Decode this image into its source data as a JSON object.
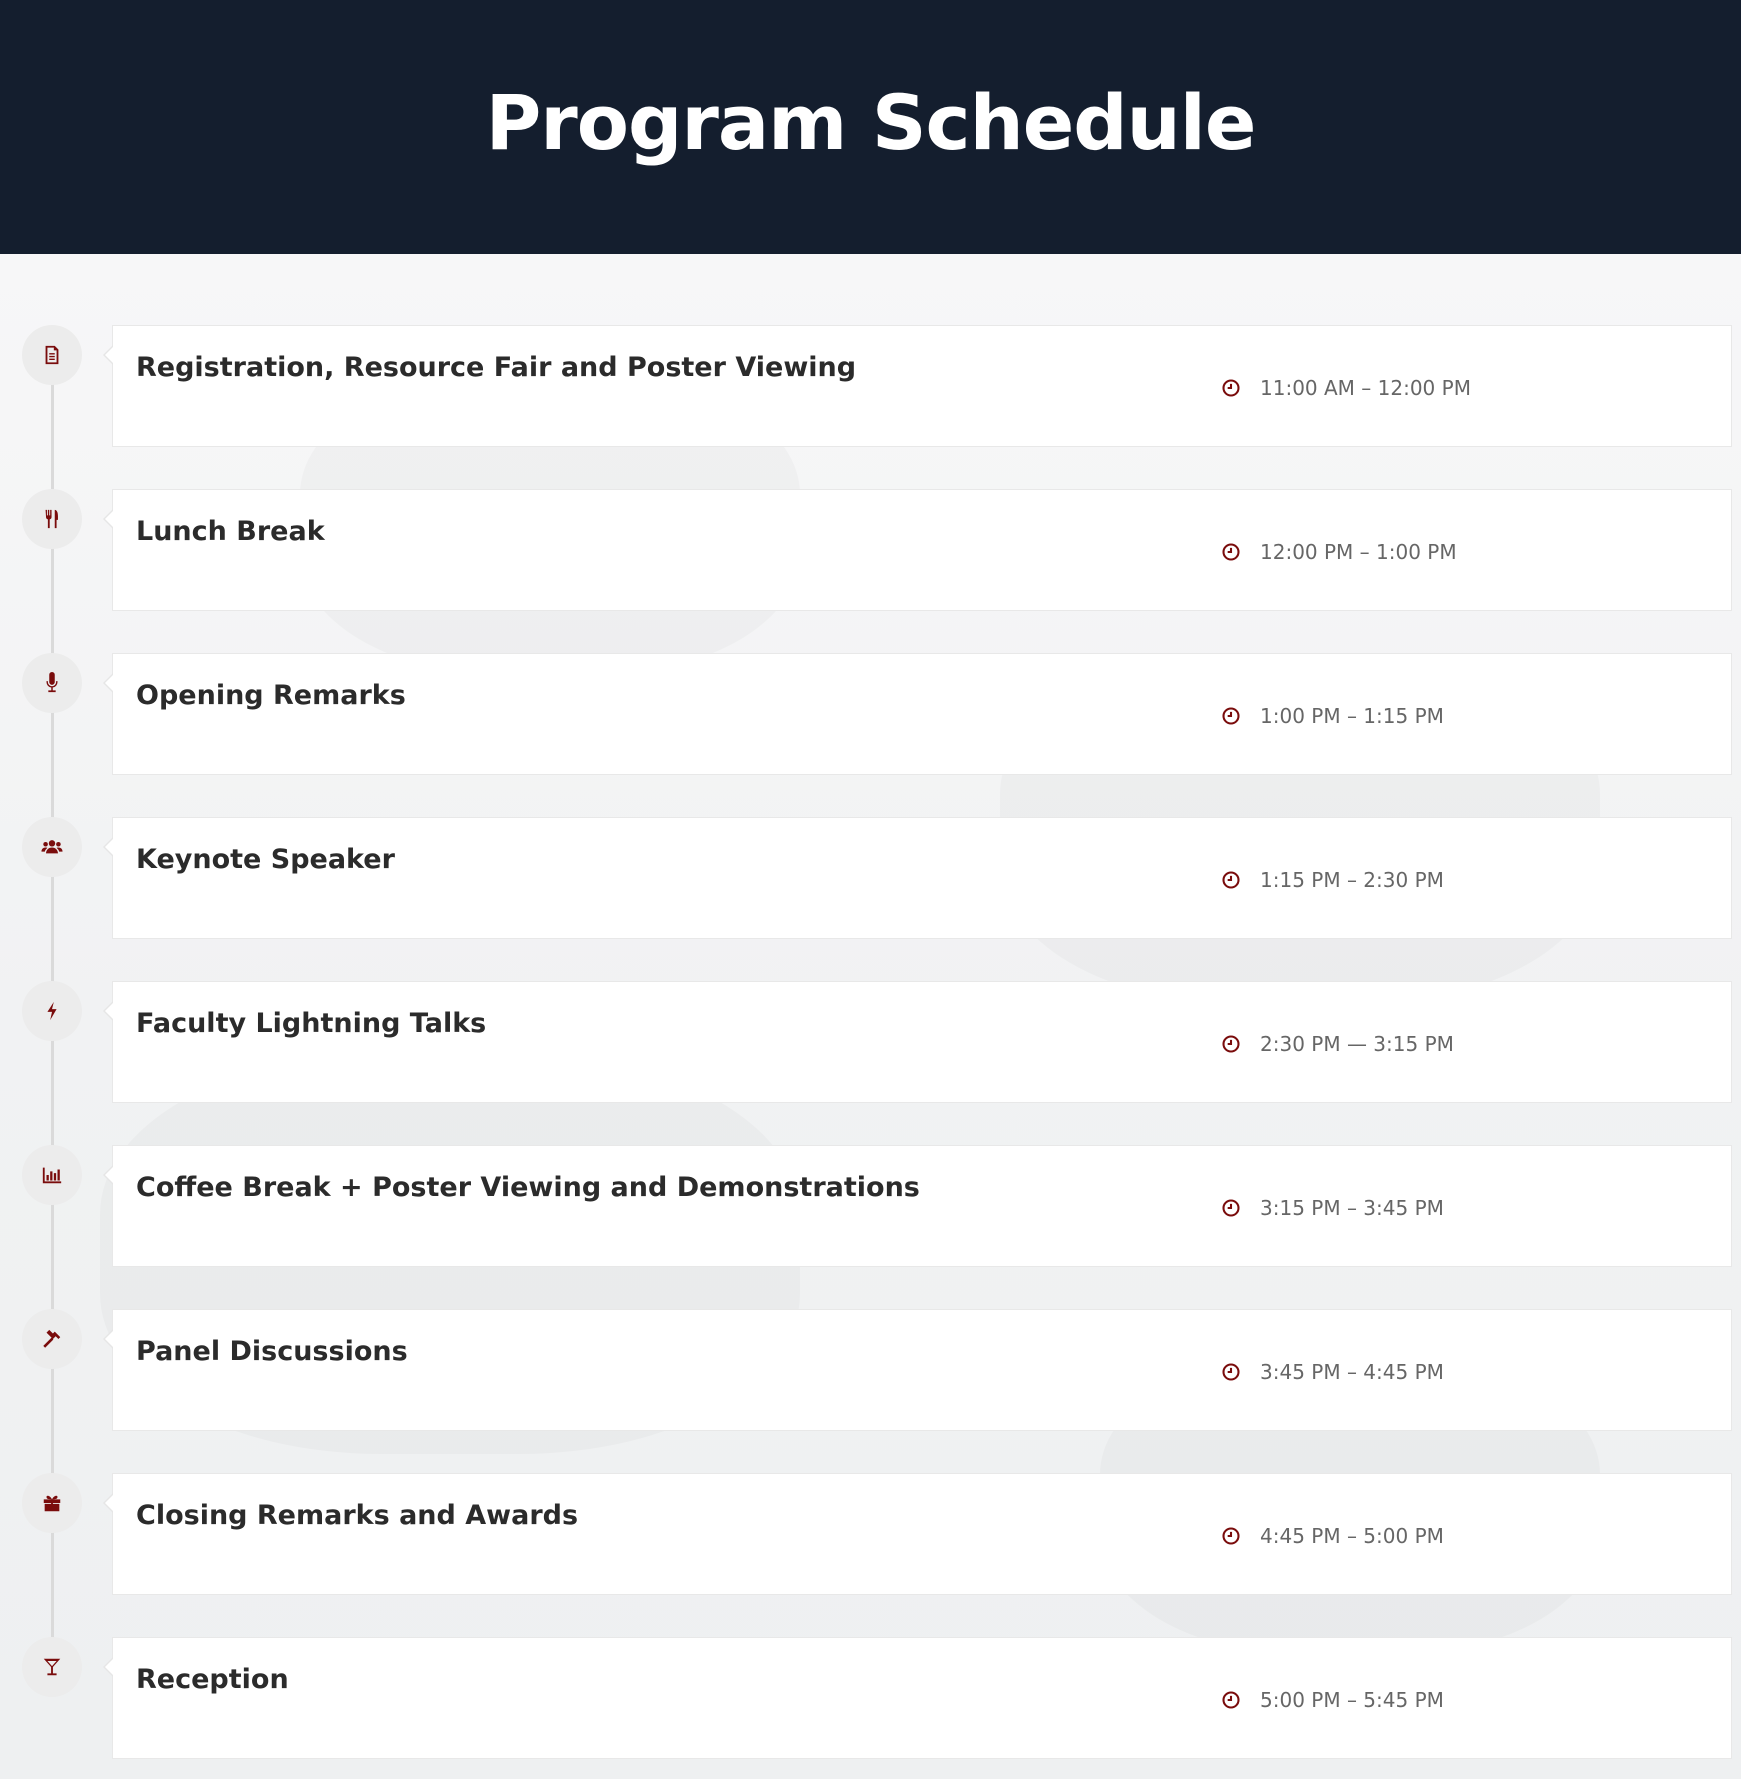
{
  "header": {
    "title": "Program Schedule"
  },
  "colors": {
    "header_bg": "#141e2e",
    "accent": "#7a0c0c",
    "text": "#2b2b2b",
    "time_text": "#666666"
  },
  "schedule": [
    {
      "icon": "document-icon",
      "title": "Registration, Resource Fair and Poster Viewing",
      "time": "11:00 AM – 12:00 PM"
    },
    {
      "icon": "utensils-icon",
      "title": "Lunch Break",
      "time": "12:00 PM – 1:00 PM"
    },
    {
      "icon": "microphone-icon",
      "title": "Opening Remarks",
      "time": "1:00 PM – 1:15 PM"
    },
    {
      "icon": "users-icon",
      "title": "Keynote Speaker",
      "time": "1:15 PM – 2:30 PM"
    },
    {
      "icon": "lightning-icon",
      "title": "Faculty Lightning Talks",
      "time": "2:30 PM — 3:15 PM"
    },
    {
      "icon": "bar-chart-icon",
      "title": "Coffee Break + Poster Viewing and Demonstrations",
      "time": "3:15 PM – 3:45 PM"
    },
    {
      "icon": "gavel-icon",
      "title": "Panel Discussions",
      "time": "3:45 PM – 4:45 PM"
    },
    {
      "icon": "gift-icon",
      "title": "Closing Remarks and Awards",
      "time": "4:45 PM – 5:00 PM"
    },
    {
      "icon": "cocktail-icon",
      "title": "Reception",
      "time": "5:00 PM – 5:45 PM"
    }
  ]
}
